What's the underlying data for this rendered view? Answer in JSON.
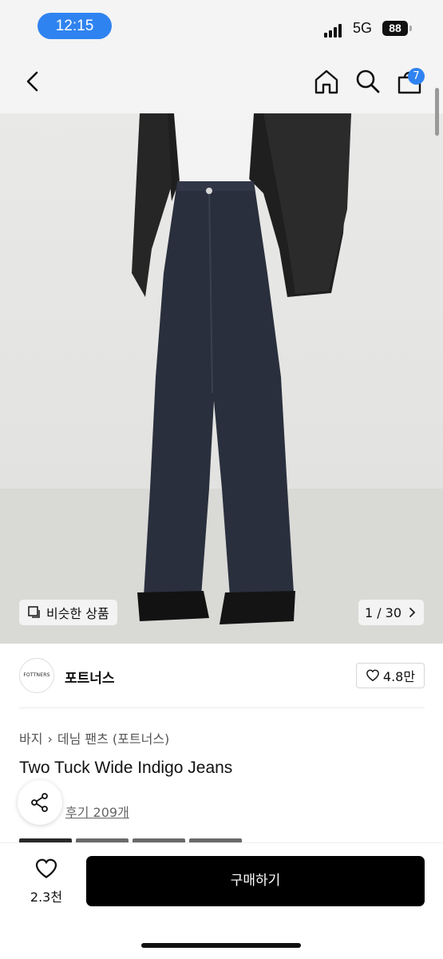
{
  "status_bar": {
    "time": "12:15",
    "network": "5G",
    "battery": "88"
  },
  "nav": {
    "cart_count": "7"
  },
  "gallery": {
    "similar_label": "비슷한 상품",
    "counter": "1 / 30"
  },
  "brand": {
    "logo_text": "FOTTNERS",
    "name": "포트너스",
    "likes": "4.8만"
  },
  "breadcrumb": {
    "level1": "바지",
    "level2": "데님 팬츠 (포트너스)"
  },
  "product": {
    "title": "Two Tuck Wide Indigo Jeans",
    "reviews": "후기 209개"
  },
  "bottom": {
    "wish_count": "2.3천",
    "buy_label": "구매하기"
  },
  "colors": {
    "accent": "#2f83f0",
    "buy_button": "#000000"
  }
}
